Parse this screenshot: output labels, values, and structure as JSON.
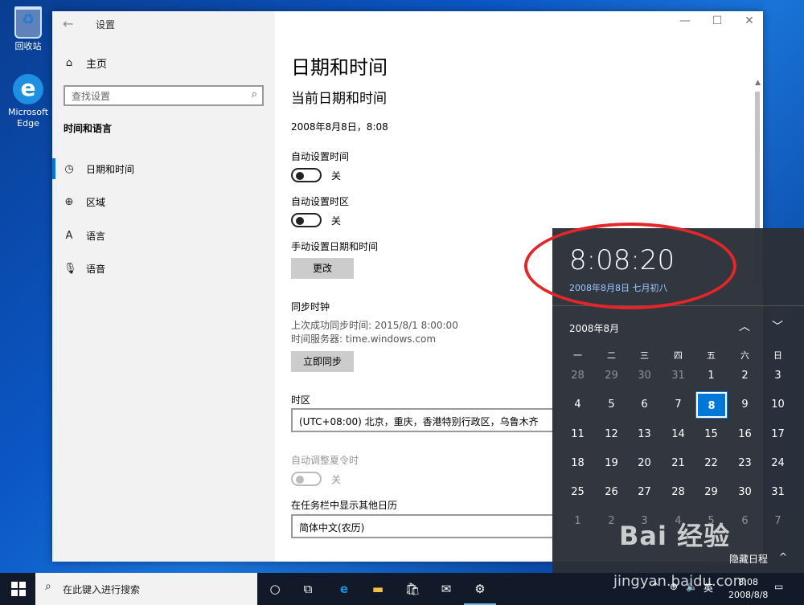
{
  "desktop": {
    "recycle_bin": "回收站",
    "edge_line1": "Microsoft",
    "edge_line2": "Edge"
  },
  "settings": {
    "title": "设置",
    "home": "主页",
    "search_placeholder": "查找设置",
    "section": "时间和语言",
    "nav": [
      {
        "label": "日期和时间",
        "icon": "calendar-clock-icon"
      },
      {
        "label": "区域",
        "icon": "globe-icon"
      },
      {
        "label": "语言",
        "icon": "language-icon"
      },
      {
        "label": "语音",
        "icon": "microphone-icon"
      }
    ]
  },
  "page": {
    "heading": "日期和时间",
    "subheading": "当前日期和时间",
    "current_datetime": "2008年8月8日，8:08",
    "auto_time_label": "自动设置时间",
    "auto_time_state": "关",
    "auto_zone_label": "自动设置时区",
    "auto_zone_state": "关",
    "manual_label": "手动设置日期和时间",
    "change_button": "更改",
    "sync_label": "同步时钟",
    "last_sync": "上次成功同步时间: 2015/8/1 8:00:00",
    "time_server": "时间服务器: time.windows.com",
    "sync_button": "立即同步",
    "timezone_label": "时区",
    "timezone_value": "(UTC+08:00) 北京，重庆，香港特别行政区，乌鲁木齐",
    "dst_label": "自动调整夏令时",
    "dst_state": "关",
    "other_calendar_label": "在任务栏中显示其他日历",
    "other_calendar_value": "简体中文(农历)"
  },
  "flyout": {
    "time": "8:08:20",
    "date": "2008年8月8日 七月初八",
    "month": "2008年8月",
    "weekdays": [
      "一",
      "二",
      "三",
      "四",
      "五",
      "六",
      "日"
    ],
    "weeks": [
      [
        "28",
        "29",
        "30",
        "31",
        "1",
        "2",
        "3"
      ],
      [
        "4",
        "5",
        "6",
        "7",
        "8",
        "9",
        "10"
      ],
      [
        "11",
        "12",
        "13",
        "14",
        "15",
        "16",
        "17"
      ],
      [
        "18",
        "19",
        "20",
        "21",
        "22",
        "23",
        "24"
      ],
      [
        "25",
        "26",
        "27",
        "28",
        "29",
        "30",
        "31"
      ],
      [
        "1",
        "2",
        "3",
        "4",
        "5",
        "6",
        "7"
      ]
    ],
    "today": "8",
    "agenda": "隐藏日程"
  },
  "taskbar": {
    "search_placeholder": "在此键入进行搜索",
    "ime": "英",
    "time": "8:08",
    "date": "2008/8/8"
  },
  "watermark": {
    "brand": "Bai 经验",
    "url": "jingyan.baidu.com"
  },
  "colors": {
    "accent": "#0078d7",
    "annotation": "#e2262a"
  }
}
